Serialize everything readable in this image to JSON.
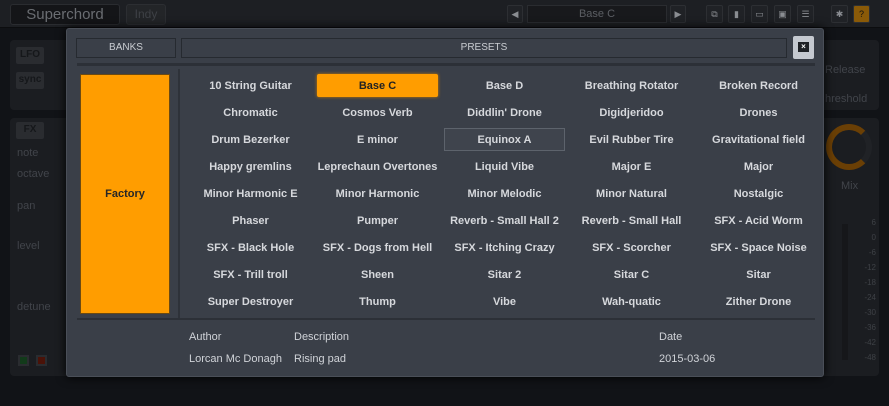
{
  "topbar": {
    "app_name": "Superchord",
    "brand": "Indy",
    "prev": "◀",
    "next": "▶",
    "preset_name": "Base C",
    "icons": [
      "copy-icon",
      "paste-icon",
      "open-icon",
      "save-icon",
      "menu-icon",
      "gear-icon",
      "help-icon"
    ]
  },
  "background": {
    "lfo": "LFO",
    "sync": "sync",
    "fx": "FX",
    "params": [
      "note",
      "octave",
      "pan",
      "level",
      "detune"
    ],
    "release": "Release",
    "threshold": "hreshold",
    "mix": "Mix",
    "meter": [
      "6",
      "0",
      "-6",
      "-12",
      "-18",
      "-24",
      "-30",
      "-36",
      "-42",
      "-48"
    ]
  },
  "dialog": {
    "banks_label": "BANKS",
    "presets_label": "PRESETS",
    "close": "×",
    "banks": [
      "Factory"
    ],
    "presets": [
      "10 String Guitar",
      "Base C",
      "Base D",
      "Breathing Rotator",
      "Broken Record",
      "Chromatic",
      "Cosmos Verb",
      "Diddlin' Drone",
      "Digidjeridoo",
      "Drones",
      "Drum Bezerker",
      "E minor",
      "Equinox A",
      "Evil Rubber Tire",
      "Gravitational field",
      "Happy gremlins",
      "Leprechaun Overtones",
      "Liquid Vibe",
      "Major E",
      "Major",
      "Minor Harmonic E",
      "Minor Harmonic",
      "Minor Melodic",
      "Minor Natural",
      "Nostalgic",
      "Phaser",
      "Pumper",
      "Reverb - Small Hall 2",
      "Reverb - Small Hall",
      "SFX - Acid Worm",
      "SFX - Black Hole",
      "SFX - Dogs from Hell",
      "SFX - Itching Crazy",
      "SFX - Scorcher",
      "SFX - Space Noise",
      "SFX - Trill troll",
      "Sheen",
      "Sitar 2",
      "Sitar C",
      "Sitar",
      "Super Destroyer",
      "Thump",
      "Vibe",
      "Wah-quatic",
      "Zither Drone"
    ],
    "selected": "Base C",
    "hovered": "Equinox A",
    "info": {
      "author_label": "Author",
      "description_label": "Description",
      "date_label": "Date",
      "author": "Lorcan Mc Donagh",
      "description": "Rising pad",
      "date": "2015-03-06"
    }
  },
  "colors": {
    "accent": "#ff9d00"
  }
}
